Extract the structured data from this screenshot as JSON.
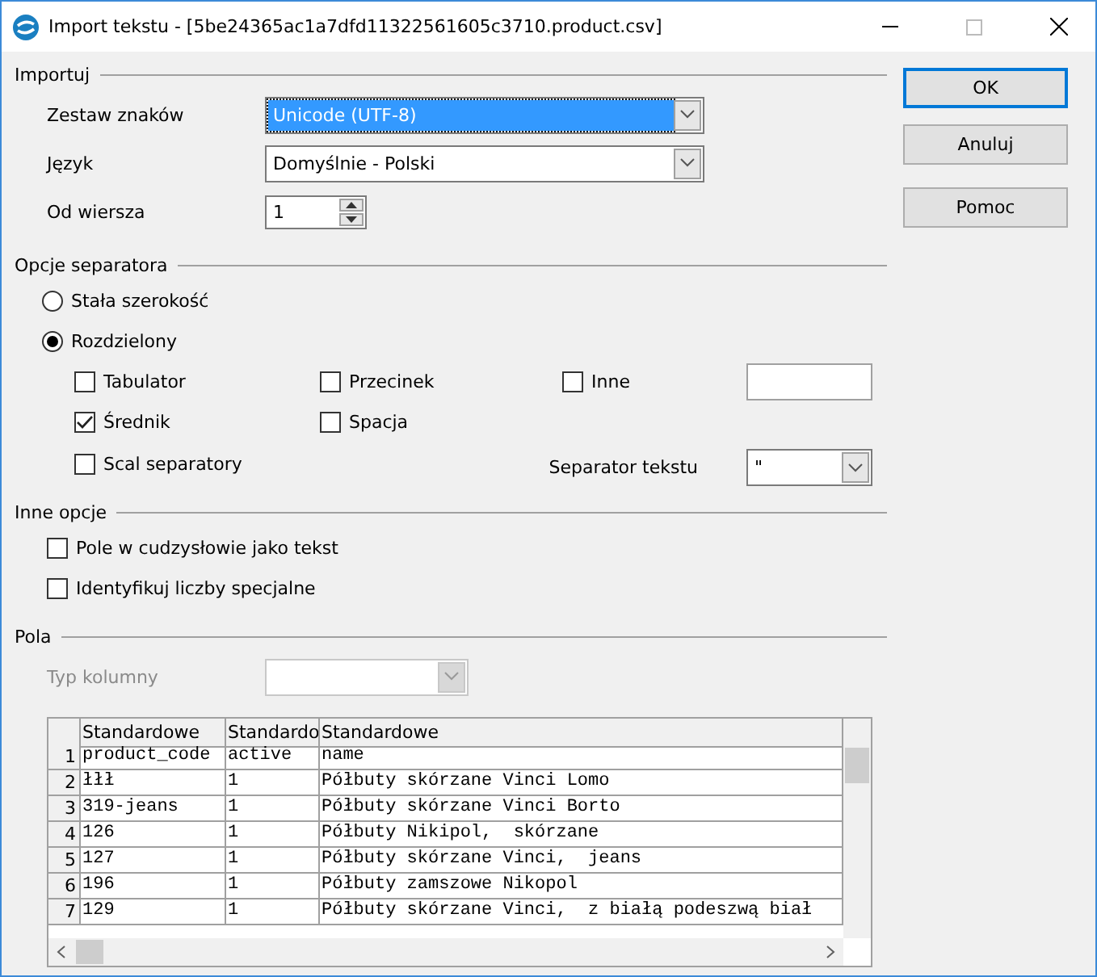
{
  "window": {
    "title": "Import tekstu - [5be24365ac1a7dfd11322561605c3710.product.csv]"
  },
  "buttons": [
    {
      "label": "OK",
      "default": true
    },
    {
      "label": "Anuluj",
      "default": false
    },
    {
      "label": "Pomoc",
      "default": false
    }
  ],
  "import": {
    "heading": "Importuj",
    "charset": {
      "label": "Zestaw znaków",
      "value": "Unicode (UTF-8)"
    },
    "language": {
      "label": "Język",
      "value": "Domyślnie - Polski"
    },
    "from_row": {
      "label": "Od wiersza",
      "value": "1"
    }
  },
  "separator_options": {
    "heading": "Opcje separatora",
    "modes": [
      {
        "label": "Stała szerokość",
        "selected": false
      },
      {
        "label": "Rozdzielony",
        "selected": true
      }
    ],
    "separators": [
      {
        "label": "Tabulator",
        "checked": false
      },
      {
        "label": "Przecinek",
        "checked": false
      },
      {
        "label": "Inne",
        "checked": false
      },
      {
        "label": "Średnik",
        "checked": true
      },
      {
        "label": "Spacja",
        "checked": false
      }
    ],
    "merge": {
      "label": "Scal separatory",
      "checked": false
    },
    "text_separator": {
      "label": "Separator tekstu",
      "value": "\""
    }
  },
  "other_options": {
    "heading": "Inne opcje",
    "items": [
      {
        "label": "Pole w cudzysłowie jako tekst",
        "checked": false
      },
      {
        "label": "Identyfikuj liczby specjalne",
        "checked": false
      }
    ]
  },
  "fields": {
    "heading": "Pola",
    "column_type": {
      "label": "Typ kolumny",
      "disabled": true
    },
    "columns": [
      "Standardowe",
      "Standardo",
      "Standardowe"
    ],
    "rows": [
      {
        "number": "1",
        "cells": [
          "product_code",
          "active",
          "name"
        ]
      },
      {
        "number": "2",
        "cells": [
          "łłł",
          "1",
          "Półbuty skórzane Vinci Lomo"
        ]
      },
      {
        "number": "3",
        "cells": [
          "319-jeans",
          "1",
          "Półbuty skórzane Vinci Borto"
        ]
      },
      {
        "number": "4",
        "cells": [
          "126",
          "1",
          "Półbuty Nikipol,  skórzane"
        ]
      },
      {
        "number": "5",
        "cells": [
          "127",
          "1",
          "Półbuty skórzane Vinci,  jeans"
        ]
      },
      {
        "number": "6",
        "cells": [
          "196",
          "1",
          "Półbuty zamszowe Nikopol"
        ]
      },
      {
        "number": "7",
        "cells": [
          "129",
          "1",
          "Półbuty skórzane Vinci,  z białą podeszwą biał"
        ]
      }
    ]
  }
}
